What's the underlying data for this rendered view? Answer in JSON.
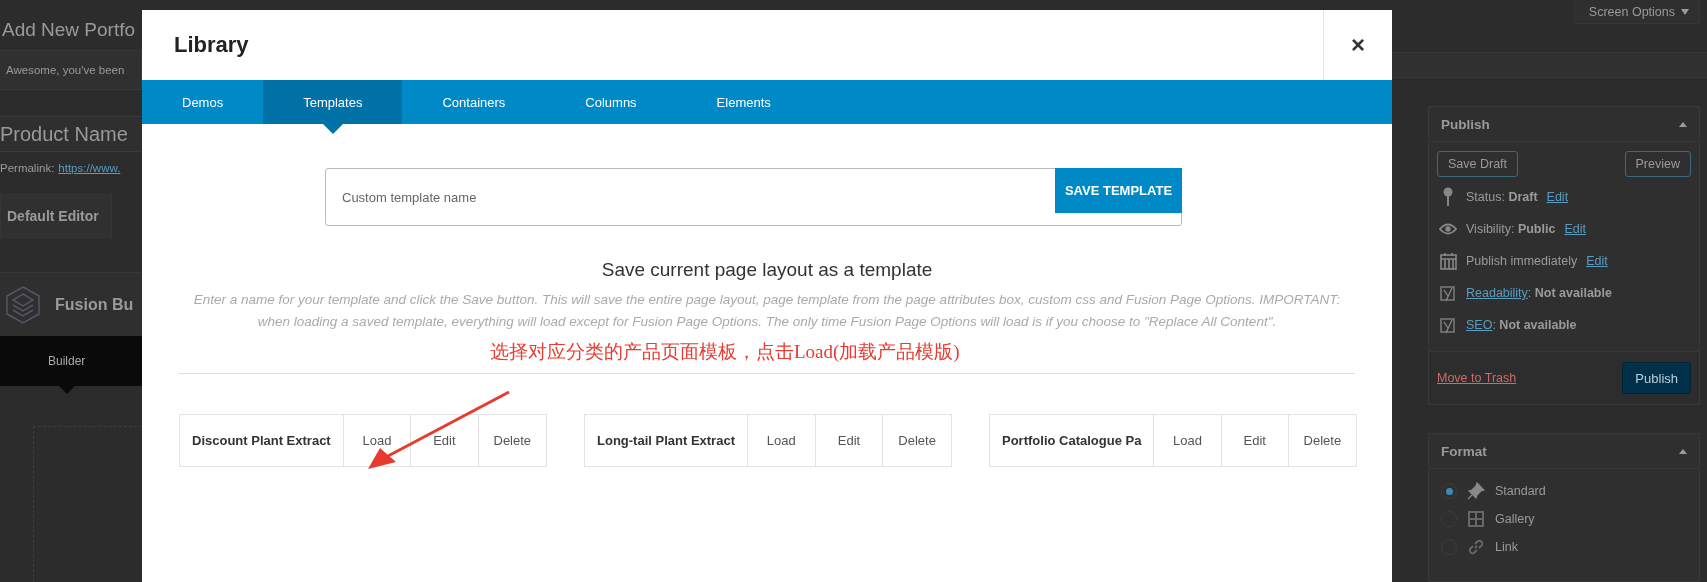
{
  "background_page": {
    "page_title": "Add New Portfo",
    "notice": "Awesome, you've been",
    "title_field": {
      "value": "Product Name"
    },
    "permalink": {
      "label": "Permalink:",
      "url": "https://www."
    },
    "default_editor_button": "Default Editor",
    "builder_panel": {
      "title": "Fusion Bu",
      "tabs": [
        {
          "label": "Builder",
          "selected": true
        }
      ]
    },
    "screen_options": "Screen Options",
    "publish_box": {
      "title": "Publish",
      "save_draft": "Save Draft",
      "preview": "Preview",
      "rows": [
        {
          "kind": "status",
          "text": "Status:",
          "value": "Draft",
          "link": "Edit"
        },
        {
          "kind": "visibility",
          "text": "Visibility:",
          "value": "Public",
          "link": "Edit"
        },
        {
          "kind": "schedule",
          "text": "Publish immediately",
          "link": "Edit"
        },
        {
          "kind": "readability",
          "link": "Readability",
          "text": ":",
          "value": "Not available"
        },
        {
          "kind": "seo",
          "link": "SEO",
          "text": ":",
          "value": "Not available"
        }
      ],
      "move_to_trash": "Move to Trash",
      "publish": "Publish"
    },
    "format_box": {
      "title": "Format",
      "options": [
        {
          "kind": "standard",
          "label": "Standard",
          "selected": true
        },
        {
          "kind": "gallery",
          "label": "Gallery",
          "selected": false
        },
        {
          "kind": "link",
          "label": "Link",
          "selected": false
        }
      ]
    }
  },
  "modal": {
    "title": "Library",
    "close": "×",
    "tabs": [
      {
        "label": "Demos",
        "selected": false
      },
      {
        "label": "Templates",
        "selected": true
      },
      {
        "label": "Containers",
        "selected": false
      },
      {
        "label": "Columns",
        "selected": false
      },
      {
        "label": "Elements",
        "selected": false
      }
    ],
    "template_name_field": {
      "placeholder": "Custom template name"
    },
    "save_button": "SAVE TEMPLATE",
    "heading": "Save current page layout as a template",
    "description": "Enter a name for your template and click the Save button. This will save the entire page layout, page template from the page attributes box, custom css and Fusion Page Options. IMPORTANT: when loading a saved template, everything will load except for Fusion Page Options. The only time Fusion Page Options will load is if you choose to \"Replace All Content\".",
    "annotation": "选择对应分类的产品页面模板，点击Load(加载产品模版)",
    "templates": [
      {
        "name": "Discount Plant Extract",
        "actions": [
          "Load",
          "Edit",
          "Delete"
        ]
      },
      {
        "name": "Long-tail Plant Extract",
        "actions": [
          "Load",
          "Edit",
          "Delete"
        ]
      },
      {
        "name": "Portfolio Catalogue Pa",
        "actions": [
          "Load",
          "Edit",
          "Delete"
        ]
      }
    ]
  }
}
